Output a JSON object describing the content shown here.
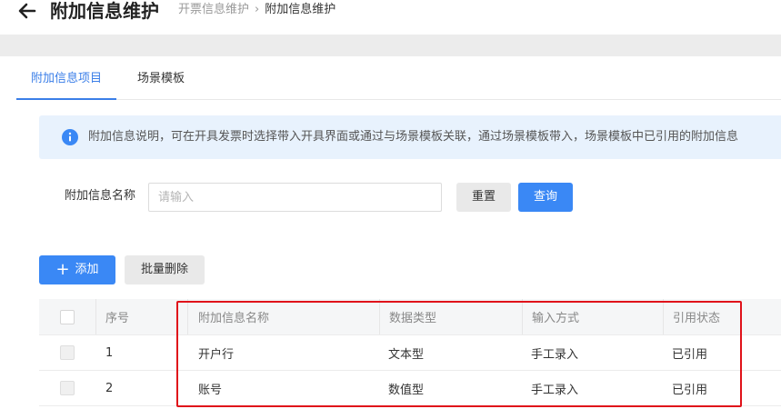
{
  "header": {
    "title": "附加信息维护",
    "breadcrumb": [
      "开票信息维护",
      "附加信息维护"
    ]
  },
  "tabs": [
    {
      "label": "附加信息项目",
      "active": true
    },
    {
      "label": "场景模板",
      "active": false
    }
  ],
  "alert": {
    "text": "附加信息说明，可在开具发票时选择带入开具界面或通过与场景模板关联，通过场景模板带入，场景模板中已引用的附加信息"
  },
  "search": {
    "label": "附加信息名称",
    "placeholder": "请输入",
    "value": "",
    "reset_label": "重置",
    "query_label": "查询"
  },
  "actions": {
    "add_label": "添加",
    "batch_delete_label": "批量删除"
  },
  "table": {
    "columns": [
      "序号",
      "附加信息名称",
      "数据类型",
      "输入方式",
      "引用状态"
    ],
    "rows": [
      [
        "1",
        "开户行",
        "文本型",
        "手工录入",
        "已引用"
      ],
      [
        "2",
        "账号",
        "数值型",
        "手工录入",
        "已引用"
      ]
    ]
  },
  "colors": {
    "primary": "#3a88f5",
    "alert_bg": "#e8f2fd",
    "highlight": "#e0121a"
  }
}
